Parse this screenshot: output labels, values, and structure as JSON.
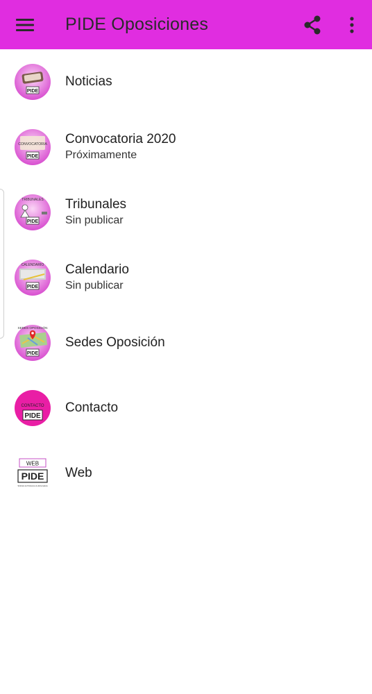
{
  "appbar": {
    "title": "PIDE Oposiciones",
    "menu_icon": "hamburger-menu-icon",
    "share_icon": "share-icon",
    "overflow_icon": "more-vert-icon",
    "background": "#e02de0"
  },
  "items": [
    {
      "title": "Noticias",
      "subtitle": "",
      "icon": "noticias-icon",
      "icon_label": ""
    },
    {
      "title": "Convocatoria 2020",
      "subtitle": "Próximamente",
      "icon": "convocatoria-icon",
      "icon_label": "CONVOCATORIA"
    },
    {
      "title": "Tribunales",
      "subtitle": "Sin publicar",
      "icon": "tribunales-icon",
      "icon_label": "TRIBUNALES"
    },
    {
      "title": "Calendario",
      "subtitle": "Sin publicar",
      "icon": "calendario-icon",
      "icon_label": "CALENDARIO"
    },
    {
      "title": "Sedes Oposición",
      "subtitle": "",
      "icon": "sedes-oposicion-icon",
      "icon_label": "SEDES OPOSICIÓN"
    },
    {
      "title": "Contacto",
      "subtitle": "",
      "icon": "contacto-icon",
      "icon_label": "CONTACTO"
    },
    {
      "title": "Web",
      "subtitle": "",
      "icon": "web-icon",
      "icon_label": "WEB"
    }
  ],
  "logo_text": "PIDE",
  "web_logo_tagline": "Sindicato de Profesores de Extremadura"
}
